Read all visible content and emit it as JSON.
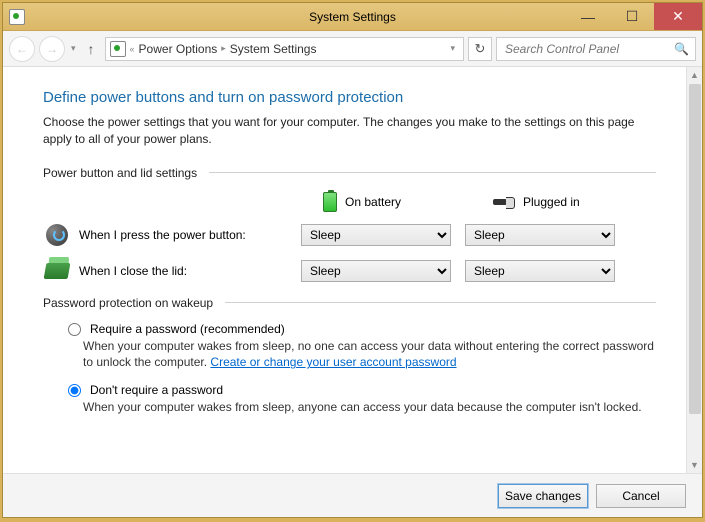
{
  "window": {
    "title": "System Settings"
  },
  "breadcrumb": {
    "prefix": "«",
    "item1": "Power Options",
    "item2": "System Settings"
  },
  "search": {
    "placeholder": "Search Control Panel"
  },
  "page": {
    "heading": "Define power buttons and turn on password protection",
    "subtitle": "Choose the power settings that you want for your computer. The changes you make to the settings on this page apply to all of your power plans."
  },
  "sections": {
    "power_button": "Power button and lid settings",
    "password": "Password protection on wakeup"
  },
  "columns": {
    "battery": "On battery",
    "plugged": "Plugged in"
  },
  "rows": {
    "power_button": {
      "label": "When I press the power button:",
      "battery": "Sleep",
      "plugged": "Sleep"
    },
    "lid": {
      "label": "When I close the lid:",
      "battery": "Sleep",
      "plugged": "Sleep"
    }
  },
  "password": {
    "require": {
      "title": "Require a password (recommended)",
      "desc_before": "When your computer wakes from sleep, no one can access your data without entering the correct password to unlock the computer. ",
      "link": "Create or change your user account password"
    },
    "dont": {
      "title": "Don't require a password",
      "desc": "When your computer wakes from sleep, anyone can access your data because the computer isn't locked.",
      "selected": true
    }
  },
  "footer": {
    "save": "Save changes",
    "cancel": "Cancel"
  }
}
